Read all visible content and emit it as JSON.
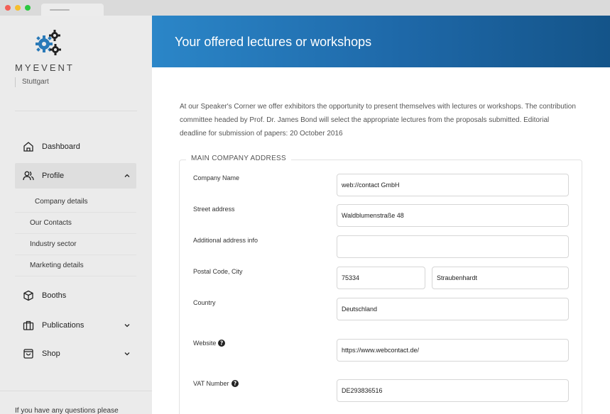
{
  "sidebar": {
    "brand": "MYEVENT",
    "city": "Stuttgart",
    "nav": {
      "dashboard": "Dashboard",
      "profile": "Profile",
      "booths": "Booths",
      "publications": "Publications",
      "shop": "Shop"
    },
    "profile_sub": [
      "Company details",
      "Our Contacts",
      "Industry sector",
      "Marketing details"
    ],
    "footer": "If you have any questions please"
  },
  "header": {
    "title": "Your offered lectures or workshops"
  },
  "intro": "At our Speaker's Corner we offer exhibitors the opportunity to present themselves with lectures or workshops. The contribution committee headed by Prof. Dr. James Bond will select the appropriate lectures from the proposals submitted. Editorial deadline for submission of papers: 20 October 2016",
  "form": {
    "legend": "MAIN COMPANY ADDRESS",
    "labels": {
      "company_name": "Company Name",
      "street": "Street address",
      "additional": "Additional address info",
      "postal_city": "Postal Code, City",
      "country": "Country",
      "website": "Website",
      "vat": "VAT Number"
    },
    "values": {
      "company_name": "web://contact GmbH",
      "street": "Waldblumenstraße 48",
      "additional": "",
      "postal": "75334",
      "city": "Straubenhardt",
      "country": "Deutschland",
      "website": "https://www.webcontact.de/",
      "vat": "DE293836516"
    }
  },
  "colors": {
    "accent": "#1e68a8",
    "sidebar_bg": "#ebebeb",
    "icon_blue": "#2a7ab8"
  }
}
